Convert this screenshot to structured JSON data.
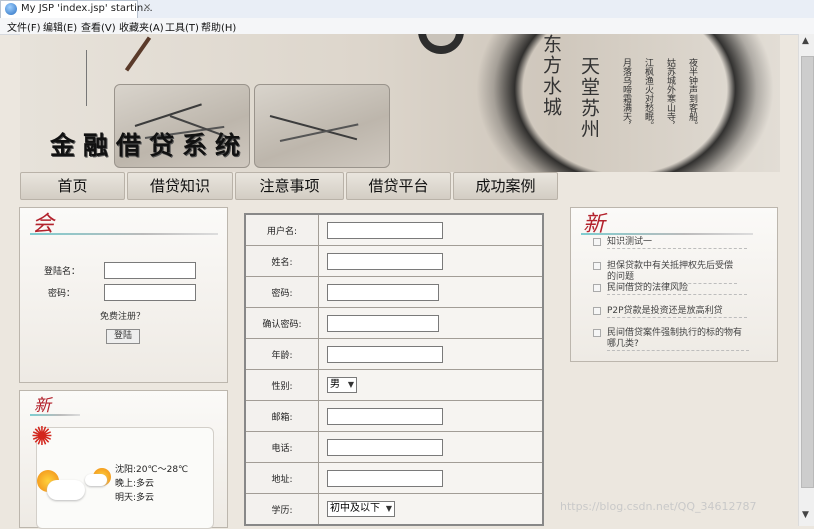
{
  "browser": {
    "tab_title": "My JSP 'index.jsp' startin...",
    "tab_close": "×",
    "menu": [
      "文件(F)",
      "编辑(E)",
      "查看(V)",
      "收藏夹(A)",
      "工具(T)",
      "帮助(H)"
    ]
  },
  "banner": {
    "title": "金融借贷系统",
    "slogan_left": "东方水城",
    "slogan_right": "天堂苏州",
    "poem": [
      "月落乌啼霜满天，",
      "江枫渔火对愁眠。",
      "姑苏城外寒山寺，",
      "夜半钟声到客船。"
    ]
  },
  "nav": [
    "首页",
    "借贷知识",
    "注意事项",
    "借贷平台",
    "成功案例"
  ],
  "login": {
    "head": "会",
    "username_label": "登陆名：",
    "password_label": "密码：",
    "register_link": "免费注册？",
    "login_button": "登陆"
  },
  "weather": {
    "head": "新",
    "today": "沈阳:20℃～28℃",
    "tonight": "晚上:多云",
    "tomorrow": "明天:多云"
  },
  "register_form": {
    "rows": [
      {
        "label": "用户名:"
      },
      {
        "label": "姓名:"
      },
      {
        "label": "密码:"
      },
      {
        "label": "确认密码:"
      },
      {
        "label": "年龄:"
      },
      {
        "label": "性别:"
      },
      {
        "label": "邮箱:"
      },
      {
        "label": "电话:"
      },
      {
        "label": "地址:"
      },
      {
        "label": "学历:"
      }
    ],
    "gender_selected": "男",
    "education_selected": "初中及以下"
  },
  "news": {
    "head": "新",
    "items": [
      "知识测试一",
      "担保贷款中有关抵押权先后受偿的问题",
      "民间借贷的法律风险",
      "P2P贷款是投资还是放高利贷",
      "民间借贷案件强制执行的标的物有哪几类?"
    ]
  },
  "watermark": "https://blog.csdn.net/QQ_34612787"
}
